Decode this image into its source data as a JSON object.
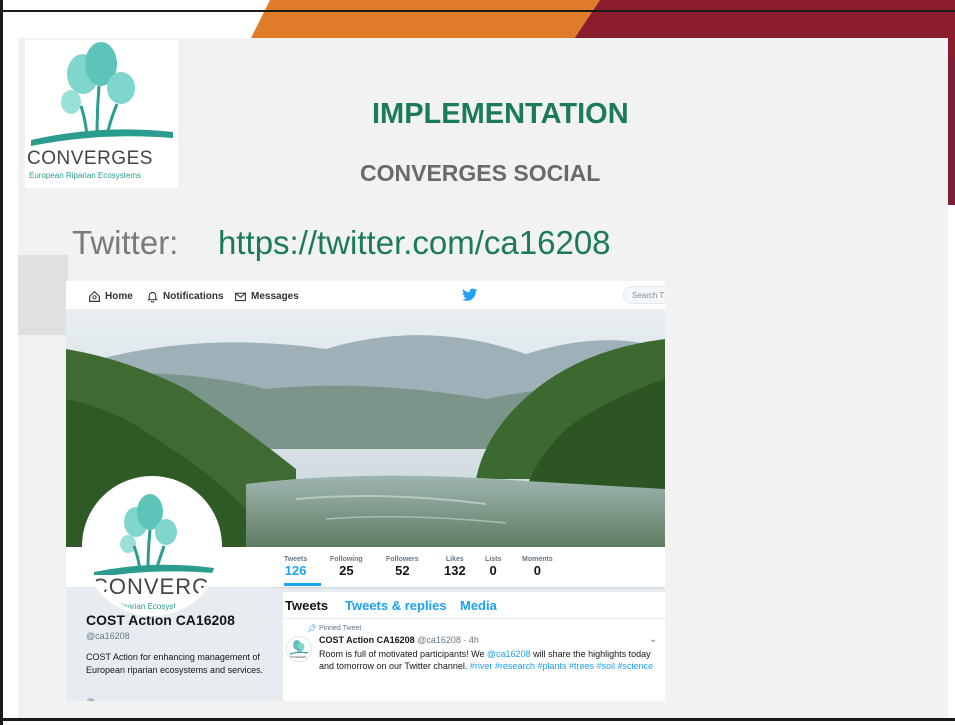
{
  "slide": {
    "title": "IMPLEMENTATION",
    "subtitle": "CONVERGES SOCIAL",
    "twitter_label": "Twitter:",
    "twitter_url": "https://twitter.com/ca16208"
  },
  "logo": {
    "name": "CONVERGES",
    "tagline": "European Riparian Ecosystems"
  },
  "twitter": {
    "nav": {
      "home": "Home",
      "notifications": "Notifications",
      "messages": "Messages",
      "search_placeholder": "Search T"
    },
    "avatar": {
      "name": "CONVERGES",
      "tagline": "ean Riparian Ecosyst"
    },
    "stats": [
      {
        "label": "Tweets",
        "value": "126"
      },
      {
        "label": "Following",
        "value": "25"
      },
      {
        "label": "Followers",
        "value": "52"
      },
      {
        "label": "Likes",
        "value": "132"
      },
      {
        "label": "Lists",
        "value": "0"
      },
      {
        "label": "Moments",
        "value": "0"
      }
    ],
    "profile": {
      "name": "COST Action CA16208",
      "handle": "@ca16208",
      "bio": "COST Action for enhancing management of European riparian ecosystems and services.",
      "more": "@"
    },
    "tabs": [
      "Tweets",
      "Tweets & replies",
      "Media"
    ],
    "tweet": {
      "pinned_label": "Pinned Tweet",
      "author": "COST Action CA16208",
      "handle_time": "@ca16208 · 4h",
      "text_before": "Room is full of motivated participants! We ",
      "mention": "@ca16208",
      "text_after": " will share the highlights today and tomorrow on our Twitter channel. ",
      "hashtags": "#river #research #plants #trees #soil #science",
      "avatar_label": "CONVERGES"
    }
  },
  "colors": {
    "title_green": "#1c7a5c",
    "twitter_blue": "#1da1f2",
    "deco_orange": "#e07b2a",
    "deco_red": "#8b1c2c"
  }
}
